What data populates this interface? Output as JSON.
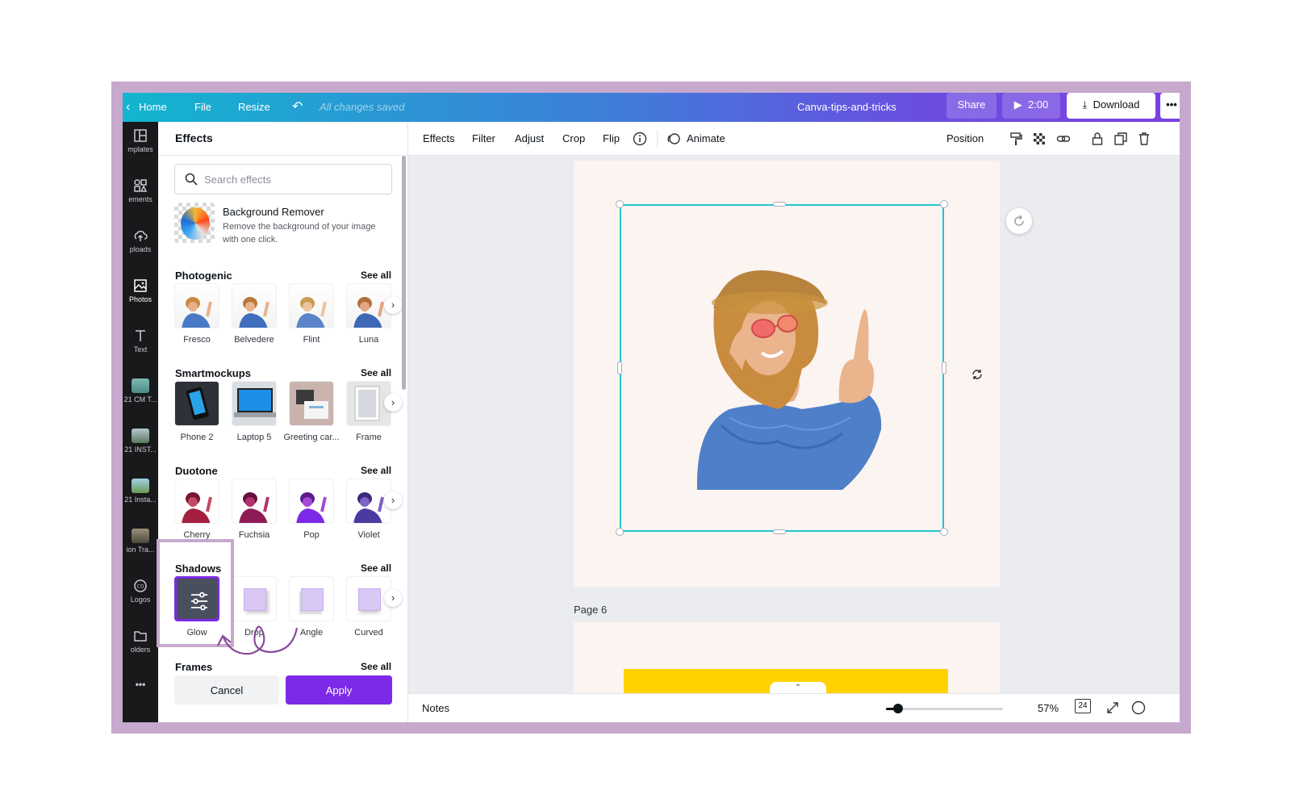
{
  "topbar": {
    "home": "Home",
    "file": "File",
    "resize": "Resize",
    "saved_status": "All changes saved",
    "doc_title": "Canva-tips-and-tricks",
    "share": "Share",
    "play_time": "2:00",
    "download": "Download",
    "more": "•••"
  },
  "rail": {
    "items": [
      {
        "label": "mplates"
      },
      {
        "label": "ements"
      },
      {
        "label": "ploads"
      },
      {
        "label": "Photos"
      },
      {
        "label": "Text"
      },
      {
        "label": "21 CM T..."
      },
      {
        "label": "21 INST..."
      },
      {
        "label": "21 Insta..."
      },
      {
        "label": "ion Tra..."
      },
      {
        "label": "Logos"
      },
      {
        "label": "olders"
      }
    ],
    "more": "•••"
  },
  "panel": {
    "title": "Effects",
    "search_placeholder": "Search effects",
    "bg_remover": {
      "title": "Background Remover",
      "desc": "Remove the background of your image with one click."
    },
    "sections": [
      {
        "title": "Photogenic",
        "see_all": "See all",
        "items": [
          "Fresco",
          "Belvedere",
          "Flint",
          "Luna"
        ]
      },
      {
        "title": "Smartmockups",
        "see_all": "See all",
        "items": [
          "Phone 2",
          "Laptop 5",
          "Greeting car...",
          "Frame"
        ]
      },
      {
        "title": "Duotone",
        "see_all": "See all",
        "items": [
          "Cherry",
          "Fuchsia",
          "Pop",
          "Violet"
        ]
      },
      {
        "title": "Shadows",
        "see_all": "See all",
        "items": [
          "Glow",
          "Drop",
          "Angle",
          "Curved"
        ]
      },
      {
        "title": "Frames",
        "see_all": "See all",
        "items": []
      }
    ],
    "cancel": "Cancel",
    "apply": "Apply"
  },
  "ctxbar": {
    "effects": "Effects",
    "filter": "Filter",
    "adjust": "Adjust",
    "crop": "Crop",
    "flip": "Flip",
    "animate": "Animate",
    "position": "Position"
  },
  "canvas": {
    "page_label": "Page 6"
  },
  "bottombar": {
    "notes": "Notes",
    "zoom": "57%",
    "zoom_level": 0.1,
    "page_count": "24"
  },
  "colors": {
    "accent": "#7d2ae8",
    "selection": "#24c4d1",
    "highlight": "#c6a9cc"
  }
}
